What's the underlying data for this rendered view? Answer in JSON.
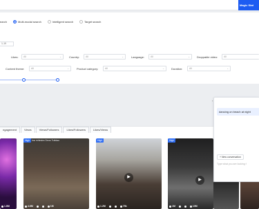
{
  "header": {
    "brand_label": "Magic Stat"
  },
  "search_modes": [
    {
      "label": "earch",
      "selected": false
    },
    {
      "label": "Multi-modal search",
      "selected": true
    },
    {
      "label": "Intelligent search",
      "selected": false
    },
    {
      "label": "Target search",
      "selected": false
    }
  ],
  "filters": {
    "date_fragment": "1-19",
    "likes": {
      "label": "Likes:",
      "value": "All"
    },
    "country": {
      "label": "Country:",
      "value": "All"
    },
    "language": {
      "label": "Language:",
      "value": "All"
    },
    "droppable_video": {
      "label": "Droppable video:",
      "value": "All"
    },
    "content_theme": {
      "label": "Content theme:",
      "value": "All"
    },
    "product_category": {
      "label": "Product category:",
      "value": "All"
    },
    "duration": {
      "label": "Duration:",
      "value": "All"
    }
  },
  "sort_tabs": [
    "ngagement",
    "Views",
    "Views/Followers",
    "Likes/Followers",
    "Likes/Views"
  ],
  "cards": [
    {
      "badge": "",
      "caption": "",
      "stats": [
        "1.8M",
        "",
        "",
        ""
      ]
    },
    {
      "badge": "High",
      "caption": "Ina mhindra  Deus Tutidao",
      "stats": [
        "4.6M",
        "",
        "",
        "1M"
      ]
    },
    {
      "badge": "High",
      "caption": "",
      "stats": [
        "1.2M",
        "",
        "",
        "75k"
      ]
    },
    {
      "badge": "High",
      "caption": "",
      "stats": [
        "1M",
        "",
        "",
        "10M"
      ]
    },
    {
      "badge": "",
      "caption": "",
      "stats": [
        "",
        "",
        "",
        ""
      ]
    },
    {
      "badge": "",
      "caption": "",
      "stats": [
        "",
        "",
        "",
        ""
      ]
    }
  ],
  "chat": {
    "user_message": "dancing on beach at night",
    "new_conversation": "+ New conversation",
    "input_placeholder": "Type what you are looking f"
  }
}
